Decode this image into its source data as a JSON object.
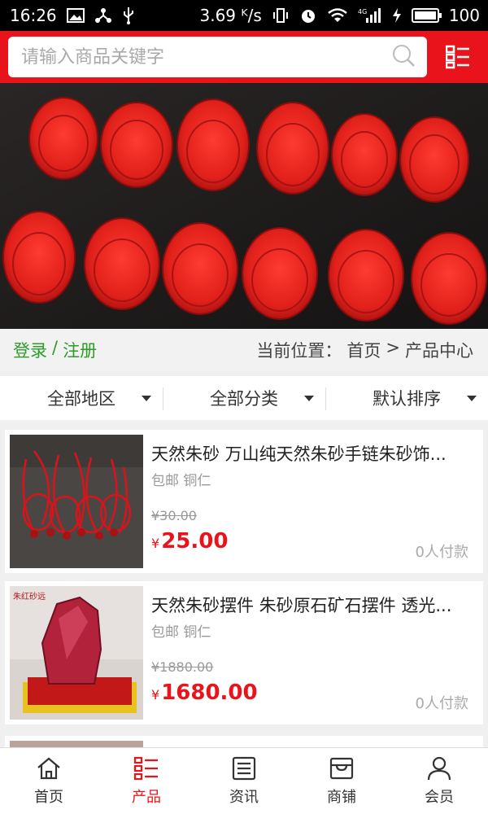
{
  "status_bar": {
    "time": "16:26",
    "network_speed": "3.69 ᴷ/s",
    "network_type": "4G",
    "battery": "100",
    "icons": [
      "image-icon",
      "share-icon",
      "usb-icon",
      "vibrate-icon",
      "alarm-icon",
      "wifi-icon",
      "signal-icon",
      "charging-icon",
      "battery-icon"
    ]
  },
  "header": {
    "search_placeholder": "请输入商品关键字",
    "accent_color": "#e9141b"
  },
  "login_bar": {
    "login": "登录",
    "separator": "/",
    "register": "注册",
    "location_label": "当前位置：",
    "home": "首页",
    "arrow": ">",
    "current": "产品中心"
  },
  "filters": [
    {
      "label": "全部地区"
    },
    {
      "label": "全部分类"
    },
    {
      "label": "默认排序"
    }
  ],
  "products": [
    {
      "title": "天然朱砂 万山纯天然朱砂手链朱砂饰...",
      "tags": "包邮 铜仁",
      "old_price": "¥30.00",
      "currency": "¥",
      "price": "25.00",
      "paid": "0人付款"
    },
    {
      "title": "天然朱砂摆件 朱砂原石矿石摆件 透光...",
      "tags": "包邮 铜仁",
      "old_price": "¥1880.00",
      "currency": "¥",
      "price": "1680.00",
      "paid": "0人付款",
      "image_text": "朱红砂远"
    }
  ],
  "tabbar": [
    {
      "label": "首页",
      "icon": "home-icon",
      "active": false
    },
    {
      "label": "产品",
      "icon": "list-icon",
      "active": true
    },
    {
      "label": "资讯",
      "icon": "news-icon",
      "active": false
    },
    {
      "label": "商铺",
      "icon": "shop-icon",
      "active": false
    },
    {
      "label": "会员",
      "icon": "user-icon",
      "active": false
    }
  ]
}
